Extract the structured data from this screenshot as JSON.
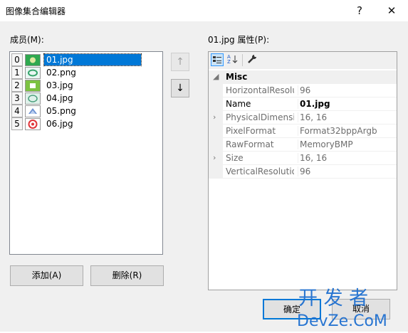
{
  "window": {
    "title": "图像集合编辑器",
    "help_glyph": "?",
    "close_glyph": "✕"
  },
  "members": {
    "label": "成员(M):",
    "items": [
      {
        "index": "0",
        "name": "01.jpg",
        "selected": true
      },
      {
        "index": "1",
        "name": "02.png"
      },
      {
        "index": "2",
        "name": "03.jpg"
      },
      {
        "index": "3",
        "name": "04.jpg"
      },
      {
        "index": "4",
        "name": "05.png"
      },
      {
        "index": "5",
        "name": "06.jpg"
      }
    ],
    "up_glyph": "↑",
    "down_glyph": "↓",
    "add_label": "添加(A)",
    "remove_label": "删除(R)"
  },
  "properties": {
    "label": "01.jpg 属性(P):",
    "category": "Misc",
    "rows": [
      {
        "name": "HorizontalResolution",
        "value": "96",
        "expandable": false,
        "bold": false
      },
      {
        "name": "Name",
        "value": "01.jpg",
        "expandable": false,
        "bold": true
      },
      {
        "name": "PhysicalDimension",
        "value": "16, 16",
        "expandable": true,
        "bold": false
      },
      {
        "name": "PixelFormat",
        "value": "Format32bppArgb",
        "expandable": false,
        "bold": false
      },
      {
        "name": "RawFormat",
        "value": "MemoryBMP",
        "expandable": false,
        "bold": false
      },
      {
        "name": "Size",
        "value": "16, 16",
        "expandable": true,
        "bold": false
      },
      {
        "name": "VerticalResolution",
        "value": "96",
        "expandable": false,
        "bold": false
      }
    ]
  },
  "footer": {
    "ok_label": "确定",
    "cancel_label": "取消"
  },
  "watermark": {
    "line1": "开 发 者",
    "line2": "DevZe.CoM"
  },
  "colors": {
    "selection": "#0078d7",
    "watermark": "#1e6fd0"
  }
}
